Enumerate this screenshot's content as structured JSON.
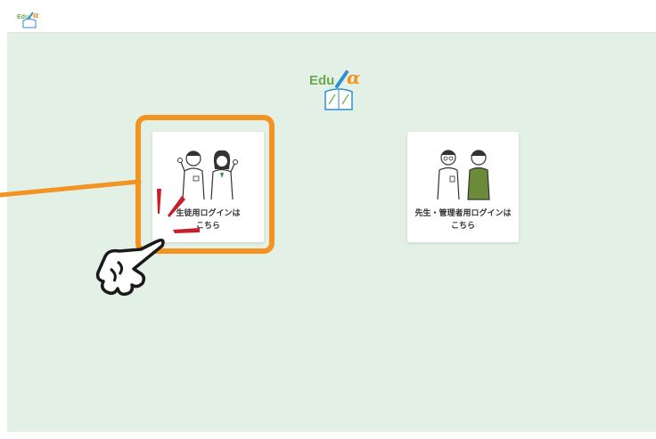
{
  "header": {
    "logo_icon": "edu-alpha-logo"
  },
  "main": {
    "logo_icon": "edu-alpha-logo",
    "logo_text": "Edu",
    "cards": [
      {
        "icon": "students-illustration",
        "line1": "生徒用ログインは",
        "line2": "こちら"
      },
      {
        "icon": "teachers-illustration",
        "line1": "先生・管理者用ログインは",
        "line2": "こちら"
      }
    ]
  },
  "overlay": {
    "highlight_color": "#f39322",
    "accent_color": "#c8202a",
    "icon": "pointing-hand-icon"
  },
  "colors": {
    "background": "#e3f0e6",
    "logo_green": "#6aa84f",
    "logo_blue": "#2f8fd0",
    "shirt_green": "#6b8a3a"
  }
}
